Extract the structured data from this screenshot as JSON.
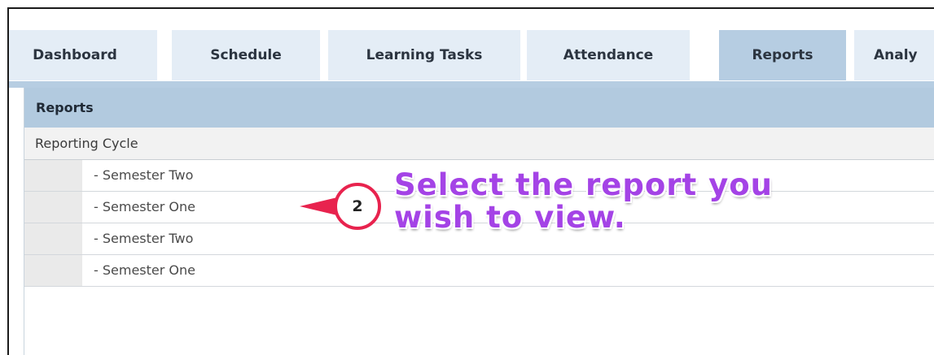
{
  "tabs": [
    {
      "label": "Dashboard",
      "active": false
    },
    {
      "label": "Schedule",
      "active": false
    },
    {
      "label": "Learning Tasks",
      "active": false
    },
    {
      "label": "Attendance",
      "active": false
    },
    {
      "label": "Reports",
      "active": true
    },
    {
      "label": "Analy",
      "active": false
    }
  ],
  "panel": {
    "title": "Reports",
    "cycle_label": "Reporting Cycle",
    "items": [
      {
        "label": "- Semester Two"
      },
      {
        "label": "- Semester One"
      },
      {
        "label": "- Semester Two"
      },
      {
        "label": "- Semester One"
      }
    ]
  },
  "callout": {
    "step": "2",
    "text": "Select the report you wish to view."
  },
  "colors": {
    "accent_tab": "#b6cde2",
    "callout_ring": "#e8234e",
    "callout_text": "#a443e6"
  }
}
